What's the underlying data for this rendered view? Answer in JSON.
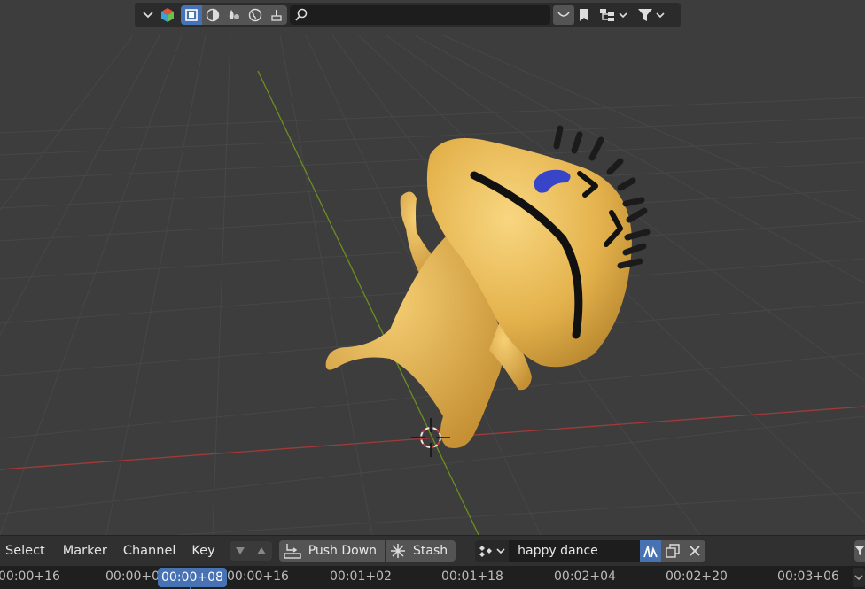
{
  "header": {
    "search": {
      "value": "",
      "placeholder": ""
    },
    "icons": [
      "chevron-down-icon",
      "object-cube-icon",
      "select-box-icon",
      "viewport-shading-icon",
      "tweak-icon",
      "world-icon",
      "paint-brush-icon",
      "search-icon",
      "mask-icon",
      "bookmark-icon",
      "outliner-icon",
      "filter-icon"
    ]
  },
  "action_editor": {
    "menus": {
      "select": "Select",
      "marker": "Marker",
      "channel": "Channel",
      "key": "Key"
    },
    "push_down": "Push Down",
    "stash": "Stash",
    "action_name": "happy dance"
  },
  "timeline": {
    "playhead": "00:00+08",
    "ticks": [
      "00:00+16",
      "00:00+0",
      "00:00+16",
      "00:01+02",
      "00:01+18",
      "00:02+04",
      "00:02+20",
      "00:03+06"
    ]
  },
  "colors": {
    "accent": "#4772b3",
    "viewport_bg": "#3d3d3d",
    "x_axis": "#a13a3a",
    "y_axis": "#6b8f1f",
    "character": "#e8b84e"
  }
}
